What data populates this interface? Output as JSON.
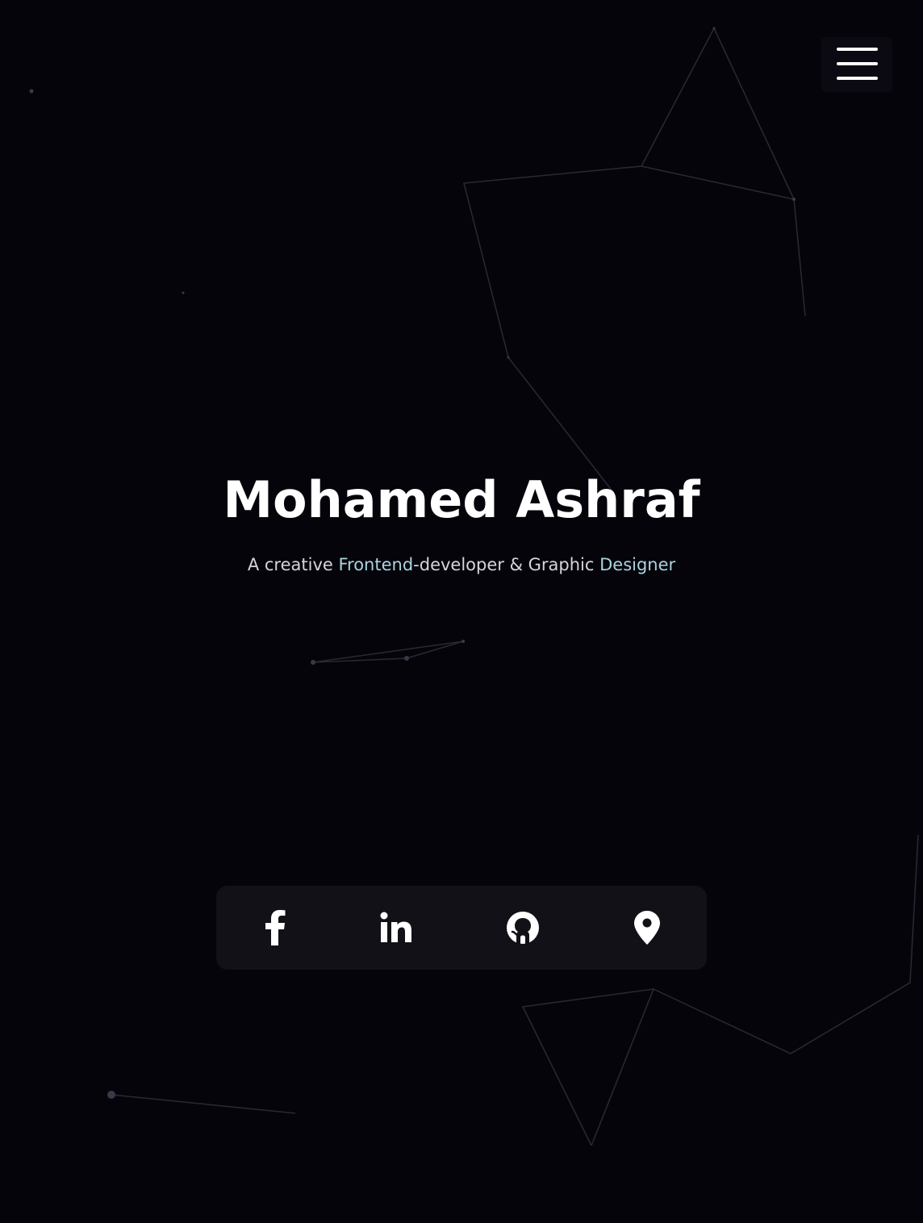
{
  "nav": {
    "menu_icon": "hamburger-menu-icon"
  },
  "hero": {
    "name": "Mohamed Ashraf",
    "subtitle_prefix": "A creative ",
    "subtitle_accent_1": "Frontend",
    "subtitle_middle": "-developer & Graphic ",
    "subtitle_accent_2": "Designer"
  },
  "social": {
    "items": [
      {
        "icon": "facebook-icon"
      },
      {
        "icon": "linkedin-icon"
      },
      {
        "icon": "github-icon"
      },
      {
        "icon": "location-pin-icon"
      }
    ]
  },
  "colors": {
    "background": "#06040b",
    "accent": "#a9d4de",
    "text": "#ffffff",
    "subtitle": "#d6d3dc",
    "social_bar": "#121118"
  }
}
